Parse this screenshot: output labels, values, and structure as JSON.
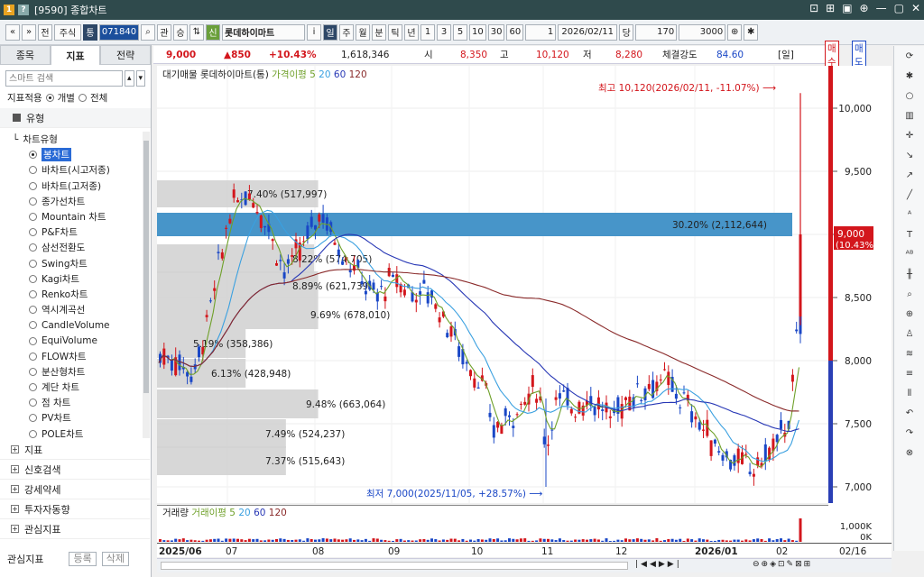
{
  "window": {
    "title": "[9590] 종합차트",
    "badge1": "1",
    "badge2": "?",
    "controls": [
      "⊡",
      "⊞",
      "▣",
      "⊕",
      "—",
      "▢",
      "✕"
    ]
  },
  "toolbar": {
    "nav1": "«",
    "nav2": "»",
    "jeon": "전",
    "market": "주식",
    "tong": "통",
    "code": "071840",
    "name": "신",
    "stock_name": "롯데하이마트",
    "info": "i",
    "periods": [
      "일",
      "주",
      "월",
      "분",
      "틱",
      "년"
    ],
    "active_period": "일",
    "nums": [
      "1",
      "3",
      "5",
      "10",
      "30",
      "60"
    ],
    "count_val": "1",
    "date": "2026/02/11",
    "dang": "당",
    "bars": "170",
    "total": "3000"
  },
  "sidebar": {
    "tabs": [
      "종목",
      "지표",
      "전략"
    ],
    "active_tab": "지표",
    "search_placeholder": "스마트 검색",
    "apply_label": "지표적용",
    "opt1": "개별",
    "opt2": "전체",
    "section": "유형",
    "chart_type_header": "차트유형",
    "items": [
      "봉차트",
      "바차트(시고저종)",
      "바차트(고저종)",
      "종가선차트",
      "Mountain 차트",
      "P&F차트",
      "삼선전환도",
      "Swing차트",
      "Kagi차트",
      "Renko차트",
      "역시계곡선",
      "CandleVolume",
      "EquiVolume",
      "FLOW차트",
      "분산형차트",
      "계단 차트",
      "점 차트",
      "PV차트",
      "POLE차트"
    ],
    "lower": [
      "지표",
      "신호검색",
      "강세약세",
      "투자자동향",
      "관심지표"
    ],
    "fav": "관심지표",
    "reg": "등록",
    "del": "삭제"
  },
  "price": {
    "cur": "9,000",
    "chg": "▲850",
    "pct": "+10.43%",
    "vol": "1,618,346",
    "open_l": "시",
    "open": "8,350",
    "high_l": "고",
    "high": "10,120",
    "low_l": "저",
    "low": "8,280",
    "str_l": "체결강도",
    "str": "84.60",
    "per": "[일]",
    "sell": "매수",
    "buy": "매도"
  },
  "legend": {
    "a": "대기매물",
    "b": "롯데하이마트(통)",
    "c": "가격이평 5",
    "d": "20",
    "e": "60",
    "f": "120"
  },
  "vol_legend": {
    "a": "거래량",
    "b": "거래이평 5",
    "c": "20",
    "d": "60",
    "e": "120"
  },
  "annotations": {
    "high": "최고 10,120(2026/02/11, -11.07%)",
    "low": "최저 7,000(2025/11/05, +28.57%)",
    "cur_price": "9,000",
    "cur_pct": "(10.43%)"
  },
  "yticks": [
    "10,000",
    "9,500",
    "9,000",
    "8,500",
    "8,000",
    "7,500",
    "7,000"
  ],
  "vticks": [
    "1,000K",
    "0K"
  ],
  "xticks": [
    "2025/06",
    "07",
    "08",
    "09",
    "10",
    "11",
    "12",
    "2026/01",
    "02"
  ],
  "last_date": "02/16",
  "profile": [
    {
      "label": "7.40% (517,997)",
      "w": 0.4
    },
    {
      "label": "30.20% (2,112,644)",
      "w": 1.0
    },
    {
      "label": "8.22% (574,705)",
      "w": 0.39
    },
    {
      "label": "8.89% (621,739)",
      "w": 0.4
    },
    {
      "label": "9.69% (678,010)",
      "w": 0.4
    },
    {
      "label": "5.19% (358,386)",
      "w": 0.22
    },
    {
      "label": "6.13% (428,948)",
      "w": 0.22
    },
    {
      "label": "9.48% (663,064)",
      "w": 0.4
    },
    {
      "label": "7.49% (524,237)",
      "w": 0.32
    },
    {
      "label": "7.37% (515,643)",
      "w": 0.32
    }
  ],
  "colors": {
    "up": "#d3161c",
    "down": "#1a47c6",
    "ma5": "#6fa02a",
    "ma20": "#3aa0e0",
    "ma60": "#2737b5",
    "ma120": "#8a2a2a",
    "profile": "#d3d3d3",
    "profile_hi": "#3d8fc6"
  }
}
